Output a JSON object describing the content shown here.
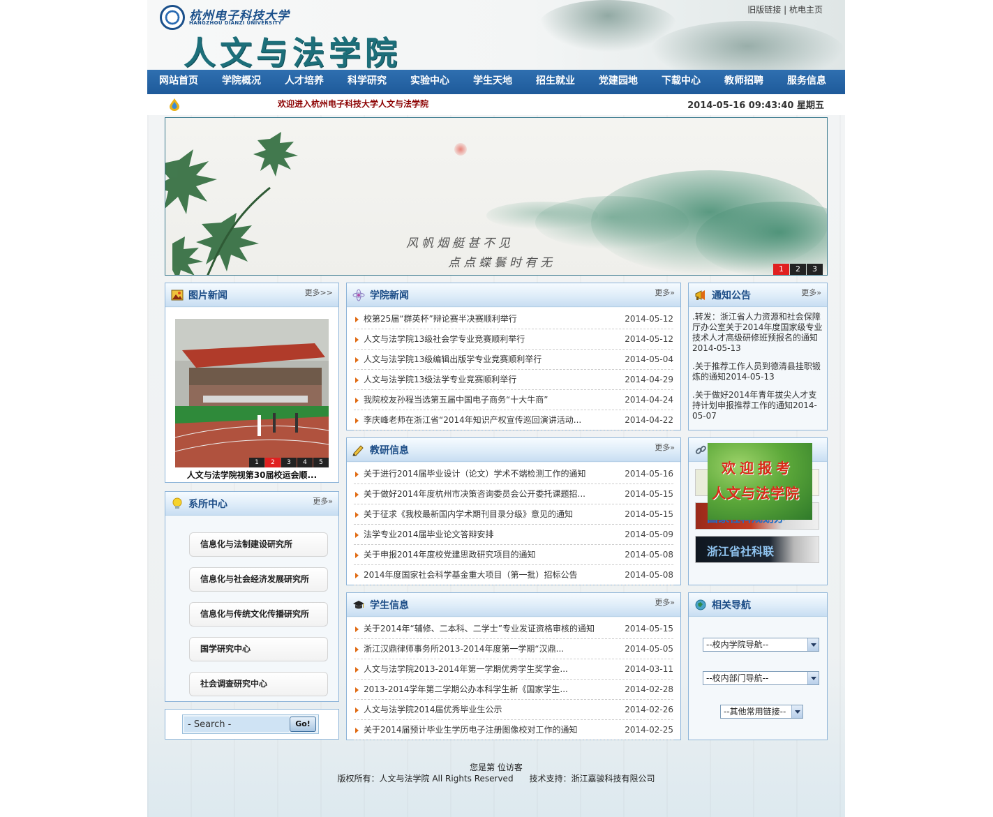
{
  "header": {
    "university_cn": "杭州电子科技大学",
    "university_en": "HANGZHOU DIANZI UNIVERSITY",
    "site_title": "人文与法学院",
    "old_link": "旧版链接",
    "separator": "|",
    "home_link": "杭电主页"
  },
  "nav": {
    "items": [
      "网站首页",
      "学院概况",
      "人才培养",
      "科学研究",
      "实验中心",
      "学生天地",
      "招生就业",
      "党建园地",
      "下载中心",
      "教师招聘",
      "服务信息"
    ]
  },
  "infobar": {
    "welcome": "欢迎进入杭州电子科技大学人文与法学院",
    "datetime": "2014-05-16 09:43:40 星期五"
  },
  "banner": {
    "poem_line1": "风帆烟艇甚不见",
    "poem_line2": "点点蝶鬟时有无",
    "pages": [
      "1",
      "2",
      "3"
    ],
    "active_page": "1"
  },
  "photo_news": {
    "title": "图片新闻",
    "more": "更多>>",
    "caption": "人文与法学院视第30届校运会顺...",
    "pages": [
      "1",
      "2",
      "3",
      "4",
      "5"
    ],
    "active_page": "2"
  },
  "depts": {
    "title": "系所中心",
    "more": "更多»",
    "items": [
      "信息化与法制建设研究所",
      "信息化与社会经济发展研究所",
      "信息化与传统文化传播研究所",
      "国学研究中心",
      "社会调查研究中心"
    ]
  },
  "search": {
    "placeholder": "- Search -",
    "button": "Go!"
  },
  "college_news": {
    "title": "学院新闻",
    "more": "更多»",
    "items": [
      {
        "title": "校第25届“群英杯”辩论赛半决赛顺利举行",
        "date": "2014-05-12"
      },
      {
        "title": "人文与法学院13级社会学专业竞赛顺利举行",
        "date": "2014-05-12"
      },
      {
        "title": "人文与法学院13级编辑出版学专业竞赛顺利举行",
        "date": "2014-05-04"
      },
      {
        "title": "人文与法学院13级法学专业竞赛顺利举行",
        "date": "2014-04-29"
      },
      {
        "title": "我院校友孙程当选第五届中国电子商务“十大牛商”",
        "date": "2014-04-24"
      },
      {
        "title": "李庆峰老师在浙江省“2014年知识产权宣传巡回演讲活动...",
        "date": "2014-04-22"
      }
    ]
  },
  "research_info": {
    "title": "教研信息",
    "more": "更多»",
    "items": [
      {
        "title": "关于进行2014届毕业设计（论文）学术不端检测工作的通知",
        "date": "2014-05-16"
      },
      {
        "title": "关于做好2014年度杭州市决策咨询委员会公开委托课题招...",
        "date": "2014-05-15"
      },
      {
        "title": "关于征求《我校最新国内学术期刊目录分级》意见的通知",
        "date": "2014-05-15"
      },
      {
        "title": "法学专业2014届毕业论文答辩安排",
        "date": "2014-05-09"
      },
      {
        "title": "关于申报2014年度校党建思政研究项目的通知",
        "date": "2014-05-08"
      },
      {
        "title": "2014年度国家社会科学基金重大项目（第一批）招标公告",
        "date": "2014-05-08"
      }
    ]
  },
  "student_info": {
    "title": "学生信息",
    "more": "更多»",
    "items": [
      {
        "title": "关于2014年“辅修、二本科、二学士”专业发证资格审核的通知",
        "date": "2014-05-15"
      },
      {
        "title": "浙江汉鼎律师事务所2013-2014年度第一学期“汉鼎...",
        "date": "2014-05-05"
      },
      {
        "title": "人文与法学院2013-2014年第一学期优秀学生奖学金...",
        "date": "2014-03-11"
      },
      {
        "title": "2013-2014学年第二学期公办本科学生新《国家学生...",
        "date": "2014-02-28"
      },
      {
        "title": "人文与法学院2014届优秀毕业生公示",
        "date": "2014-02-26"
      },
      {
        "title": "关于2014届预计毕业生学历电子注册图像校对工作的通知",
        "date": "2014-02-25"
      }
    ]
  },
  "notices": {
    "title": "通知公告",
    "more": "更多»",
    "items": [
      ".转发：浙江省人力资源和社会保障厅办公室关于2014年度国家级专业技术人才高级研修班预报名的通知2014-05-13",
      ".关于推荐工作人员到德清县挂职锻炼的通知2014-05-13",
      ".关于做好2014年青年拔尖人才支持计划申报推荐工作的通知2014-05-07"
    ]
  },
  "links": {
    "popup_line1": "欢迎报考",
    "popup_line2": "人文与法学院",
    "items": [
      "国家社科规划办",
      "浙江省社科联"
    ]
  },
  "related_nav": {
    "title": "相关导航",
    "select1": "--校内学院导航--",
    "select2": "--校内部门导航--",
    "select3": "--其他常用链接--"
  },
  "footer": {
    "visitors": "您是第 位访客",
    "copyright": "版权所有：人文与法学院 All Rights Reserved      技术支持：浙江嘉骏科技有限公司"
  },
  "colors": {
    "nav_bg": "#1e5a9a",
    "title_blue": "#1b4c86",
    "welcome_red": "#8b0000",
    "active_red": "#e02020",
    "bullet_orange": "#e06a12"
  }
}
